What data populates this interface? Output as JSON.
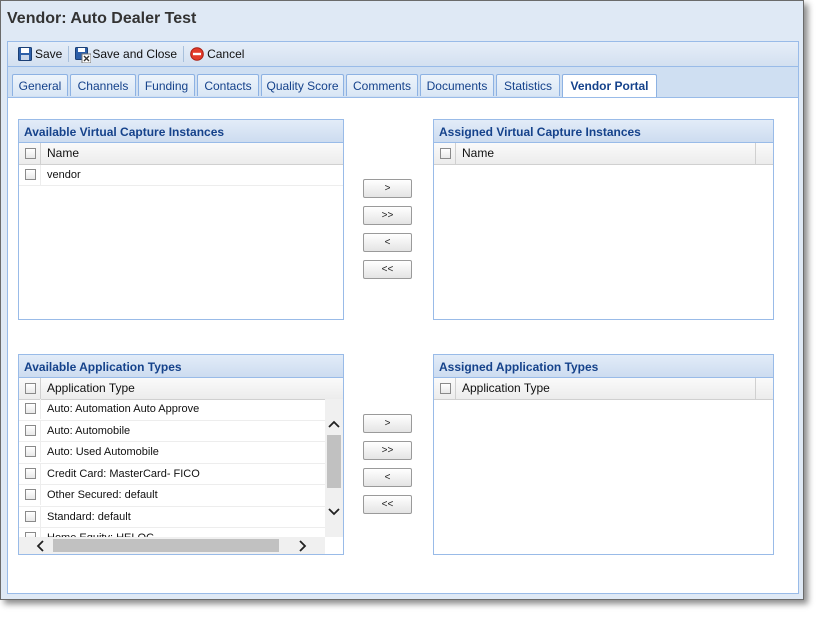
{
  "window": {
    "title": "Vendor: Auto Dealer Test"
  },
  "toolbar": {
    "save_label": "Save",
    "save_close_label": "Save and Close",
    "cancel_label": "Cancel"
  },
  "tabs": [
    "General",
    "Channels",
    "Funding",
    "Contacts",
    "Quality Score",
    "Comments",
    "Documents",
    "Statistics",
    "Vendor Portal"
  ],
  "active_tab": "Vendor Portal",
  "capture": {
    "available_title": "Available Virtual Capture Instances",
    "assigned_title": "Assigned Virtual Capture Instances",
    "column": "Name",
    "available_items": [
      "vendor"
    ],
    "assigned_items": []
  },
  "apptypes": {
    "available_title": "Available Application Types",
    "assigned_title": "Assigned Application Types",
    "column": "Application Type",
    "available_items": [
      "Auto: Automation Auto Approve",
      "Auto: Automobile",
      "Auto: Used Automobile",
      "Credit Card: MasterCard- FICO",
      "Other Secured: default",
      "Standard: default",
      "Home Equity: HELOC"
    ],
    "assigned_items": []
  },
  "move_buttons": {
    "move_one": ">",
    "move_all": ">>",
    "remove_one": "<",
    "remove_all": "<<"
  },
  "colors": {
    "panel_border": "#99bbe8",
    "header_text": "#15428b",
    "window_bg": "#dfe9f5"
  },
  "icons": {
    "save": "floppy-disk-icon",
    "save_close": "floppy-close-icon",
    "cancel": "no-entry-icon"
  }
}
